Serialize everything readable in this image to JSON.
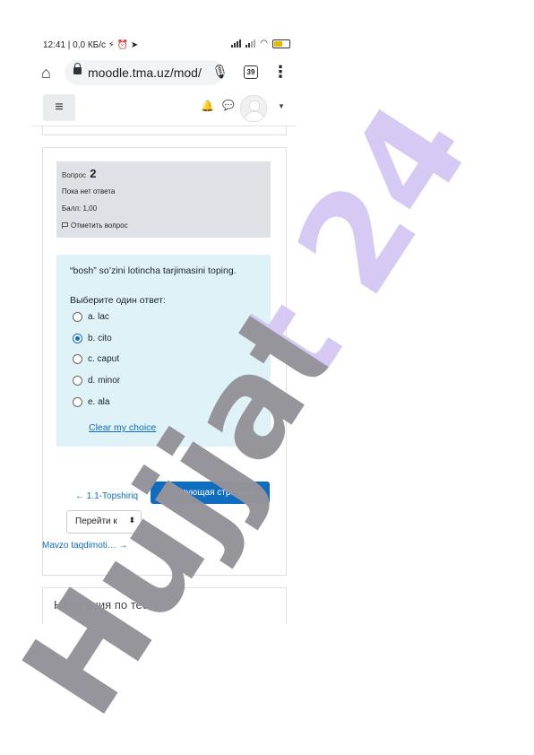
{
  "status_bar": {
    "left": "12:41 | 0,0 КБ/с ⚡ ⏰ ➤",
    "wifi_icon": "wifi-icon",
    "battery_icon": "battery-icon"
  },
  "browser": {
    "url": "moodle.tma.uz/mod/",
    "tab_count": "39"
  },
  "question": {
    "label": "Вопрос",
    "number": "2",
    "state": "Пока нет ответа",
    "mark": "Балл: 1,00",
    "flag_label": "Отметить вопрос",
    "text": "“bosh” so’zini lotincha tarjimasini toping.",
    "prompt": "Выберите один ответ:",
    "options": [
      {
        "label": "a. lac",
        "selected": false
      },
      {
        "label": "b. cito",
        "selected": true
      },
      {
        "label": "c. caput",
        "selected": false
      },
      {
        "label": "d. minor",
        "selected": false
      },
      {
        "label": "e. ala",
        "selected": false
      }
    ],
    "clear_label": "Clear my choice"
  },
  "navigation": {
    "prev_label": "← 1.1-Topshiriq",
    "next_label": "Следующая страница",
    "jump_label": "Перейти к",
    "next_activity": "Mavzo taqdimoti… →",
    "quiz_nav_title": "Навигация по тесту"
  },
  "watermark": {
    "text": "Hujjat 24"
  },
  "colors": {
    "accent": "#0f6cbf",
    "question_bg": "#def2f8",
    "info_bg": "#dee2e6"
  }
}
